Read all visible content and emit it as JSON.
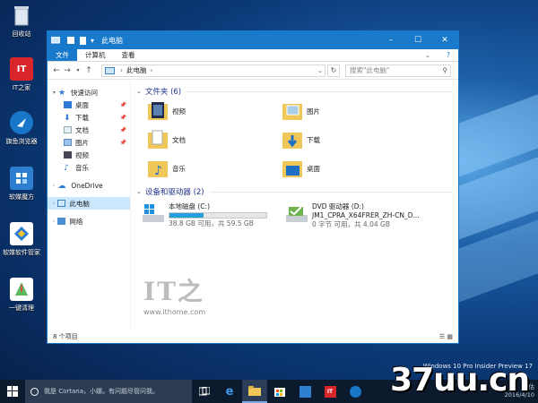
{
  "desktop": {
    "icons": [
      {
        "label": "回收站",
        "icon": "recycle-bin-icon"
      },
      {
        "label": "IT之家",
        "icon": "ithome-icon"
      },
      {
        "label": "旗鱼浏览器",
        "icon": "browser-icon"
      },
      {
        "label": "软媒魔方",
        "icon": "cube-icon"
      },
      {
        "label": "软媒软件管家",
        "icon": "software-manager-icon"
      },
      {
        "label": "一键清理",
        "icon": "cleanup-icon"
      }
    ]
  },
  "window": {
    "title": "此电脑",
    "ribbon_tabs": [
      "文件",
      "计算机",
      "查看"
    ],
    "address": "此电脑",
    "search_placeholder": "搜索\"此电脑\"",
    "sidebar": {
      "quick_access": "快速访问",
      "quick_items": [
        "桌面",
        "下载",
        "文档",
        "图片",
        "视频",
        "音乐"
      ],
      "onedrive": "OneDrive",
      "this_pc": "此电脑",
      "network": "网络"
    },
    "folders_header": "文件夹 (6)",
    "folders": [
      "视频",
      "图片",
      "文档",
      "下载",
      "音乐",
      "桌面"
    ],
    "devices_header": "设备和驱动器 (2)",
    "drives": [
      {
        "name": "本地磁盘 (C:)",
        "free": "38.8 GB 可用，共 59.5 GB",
        "used_pct": 35
      },
      {
        "name": "DVD 驱动器 (D:)",
        "label": "JM1_CPRA_X64FRER_ZH-CN_D...",
        "free": "0 字节 可用，共 4.04 GB",
        "used_pct": 100
      }
    ],
    "status": "8 个项目",
    "watermark_url": "www.ithome.com",
    "watermark_logo": "IT之"
  },
  "taskbar": {
    "cortana_text": "我是 Cortana，小娜。有问题尽管问我。",
    "tray_line1": "评估",
    "tray_line2": "2016/4/10",
    "insider": "Windows 10 Pro Insider Preview",
    "build_suffix": "17",
    "brand": "37uu.cn"
  },
  "colors": {
    "accent": "#1979ca",
    "header": "#1e3287",
    "bar": "#26a0da"
  }
}
